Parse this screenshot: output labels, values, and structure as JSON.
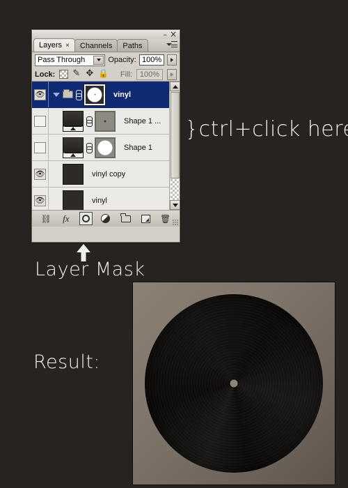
{
  "background_color": "#272320",
  "panel": {
    "window_buttons": {
      "minimize": "–",
      "close": "×"
    },
    "tabs": [
      {
        "label": "Layers",
        "active": true,
        "close_glyph": "×"
      },
      {
        "label": "Channels",
        "active": false
      },
      {
        "label": "Paths",
        "active": false
      }
    ],
    "blend_mode": {
      "value": "Pass Through"
    },
    "opacity": {
      "label": "Opacity:",
      "value": "100%"
    },
    "lock": {
      "label": "Lock:",
      "icons": [
        "lock-transparency-icon",
        "lock-image-icon",
        "lock-position-icon",
        "lock-all-icon"
      ]
    },
    "fill": {
      "label": "Fill:",
      "value": "100%"
    },
    "layers": [
      {
        "name": "vinyl",
        "visible": true,
        "selected": true,
        "type": "group",
        "has_disclosure": true,
        "has_folder": true,
        "has_link": true,
        "thumb": "white-circle-mask",
        "indented": false
      },
      {
        "name": "Shape 1 ...",
        "visible": false,
        "selected": false,
        "type": "shape",
        "has_disclosure": false,
        "has_folder": false,
        "has_link": true,
        "thumb": "gradient-with-slider",
        "mask_thumb": "gray-dot-vector-mask",
        "indented": true
      },
      {
        "name": "Shape 1",
        "visible": false,
        "selected": false,
        "type": "shape",
        "has_disclosure": false,
        "has_folder": false,
        "has_link": true,
        "thumb": "gradient-with-slider",
        "mask_thumb": "white-circle-vector-mask",
        "indented": true
      },
      {
        "name": "vinyl copy",
        "visible": true,
        "selected": false,
        "type": "raster",
        "has_disclosure": false,
        "has_folder": false,
        "has_link": false,
        "thumb": "dark-solid",
        "indented": true
      },
      {
        "name": "vinyl",
        "visible": true,
        "selected": false,
        "type": "raster",
        "has_disclosure": false,
        "has_folder": false,
        "has_link": false,
        "thumb": "dark-solid",
        "indented": true
      }
    ],
    "toolbar": [
      {
        "name": "link-layers-icon",
        "label": "Link layers"
      },
      {
        "name": "layer-style-fx-icon",
        "label": "Add a layer style"
      },
      {
        "name": "add-layer-mask-icon",
        "label": "Add layer mask"
      },
      {
        "name": "adjustment-layer-icon",
        "label": "Create new fill or adjustment layer"
      },
      {
        "name": "new-group-icon",
        "label": "Create a new group"
      },
      {
        "name": "new-layer-icon",
        "label": "Create a new layer"
      },
      {
        "name": "delete-layer-icon",
        "label": "Delete layer"
      }
    ],
    "scrollbar": {
      "up_arrow": "▲",
      "down_arrow": "▼"
    }
  },
  "annotations": {
    "ctrl_click": "}ctrl+click here",
    "layer_mask": "Layer Mask",
    "result": "Result:",
    "arrow": "up-arrow"
  },
  "result_image": {
    "subject": "black-vinyl-record",
    "background_color": "#80756a",
    "record_color": "#0d0c0b",
    "spindle_color": "#8d8378"
  }
}
